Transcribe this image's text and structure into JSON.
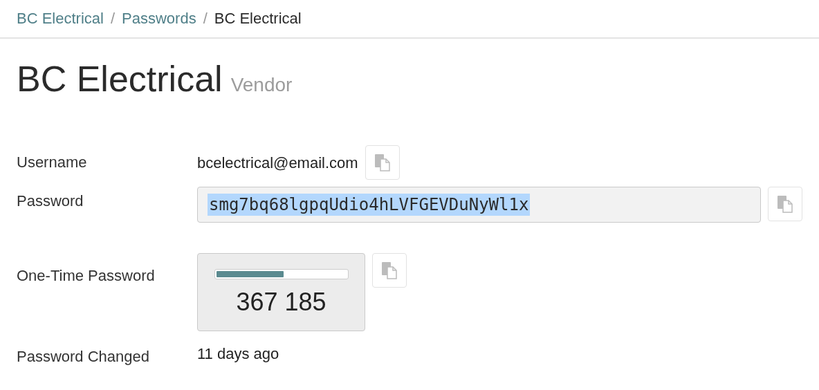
{
  "breadcrumb": [
    {
      "label": "BC Electrical",
      "kind": "link"
    },
    {
      "label": "Passwords",
      "kind": "link"
    },
    {
      "label": "BC Electrical",
      "kind": "current"
    }
  ],
  "breadcrumb_separator": "/",
  "title": "BC Electrical",
  "subtitle": "Vendor",
  "fields": [
    {
      "kind": "text",
      "label": "Username",
      "value": "bcelectrical@email.com"
    },
    {
      "kind": "password",
      "label": "Password",
      "value": "smg7bq68lgpqUdio4hLVFGEVDuNyWl1x",
      "text_selected": true
    },
    {
      "kind": "otp",
      "label": "One-Time Password",
      "value": "367 185",
      "level": 0.52
    },
    {
      "kind": "plain",
      "label": "Password Changed",
      "value": "11 days ago"
    }
  ]
}
